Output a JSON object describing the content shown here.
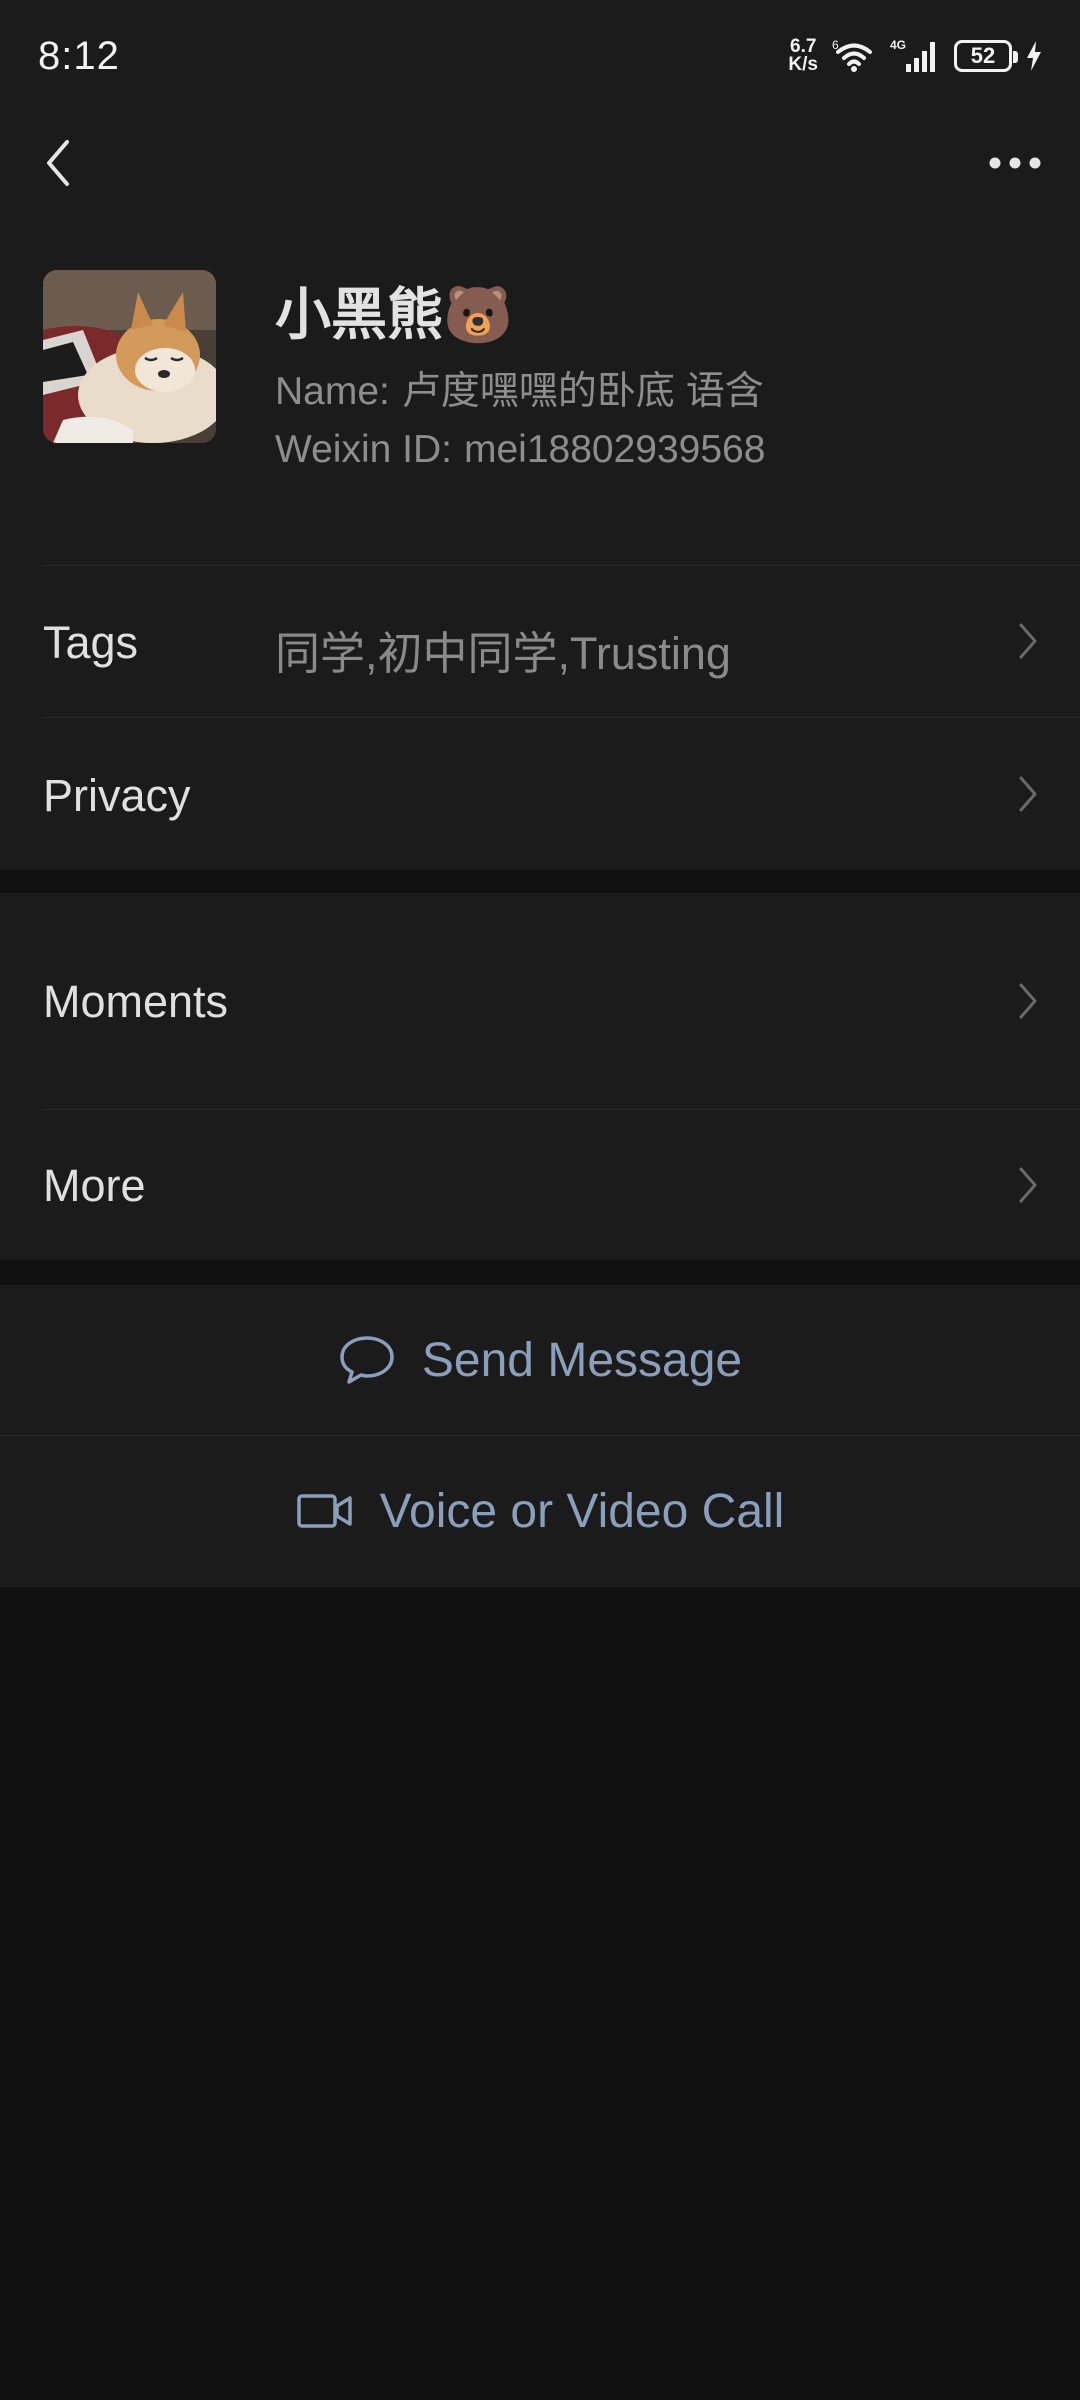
{
  "status_bar": {
    "time": "8:12",
    "net_speed_value": "6.7",
    "net_speed_unit": "K/s",
    "wifi_label": "6",
    "mobile_label": "4G",
    "battery": "52"
  },
  "nav": {
    "back_icon": "chevron-left-icon",
    "more_icon": "more-dots-icon"
  },
  "profile": {
    "display_name": "小黑熊🐻",
    "name_label": "Name:",
    "name_value": "卢度嘿嘿的卧底 语含",
    "weixin_id_label": "Weixin ID:",
    "weixin_id_value": "mei18802939568"
  },
  "info_rows": [
    {
      "label": "Tags",
      "value": "同学,初中同学,Trusting"
    },
    {
      "label": "Privacy",
      "value": ""
    }
  ],
  "feature_rows": [
    {
      "label": "Moments"
    },
    {
      "label": "More"
    }
  ],
  "actions": {
    "send_message": {
      "label": "Send Message",
      "icon": "chat-bubble-icon"
    },
    "call": {
      "label": "Voice or Video Call",
      "icon": "video-camera-icon"
    }
  },
  "colors": {
    "background": "#111111",
    "surface": "#1b1b1b",
    "accent_link": "#8a9fbb"
  }
}
